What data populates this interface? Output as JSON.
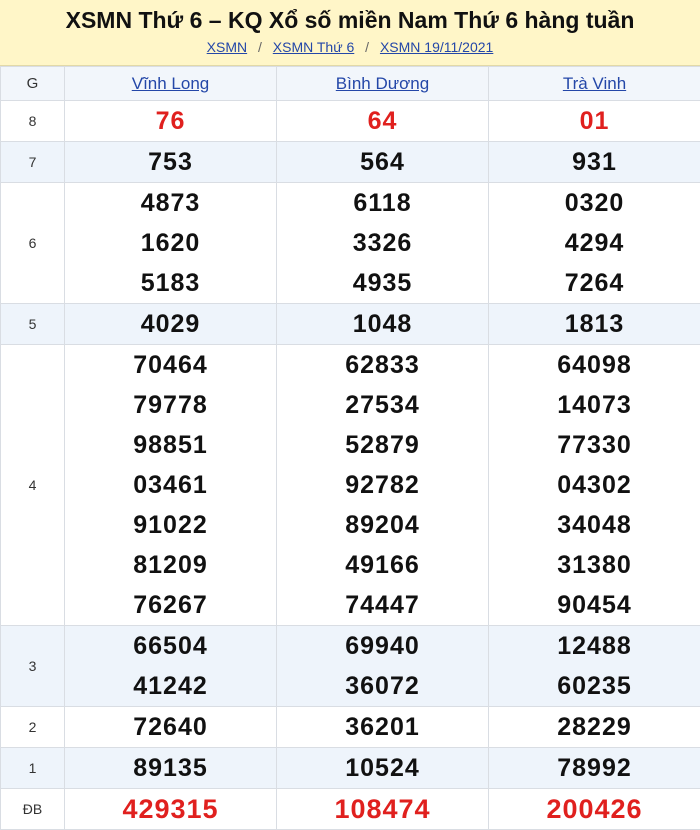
{
  "header": {
    "title": "XSMN Thứ 6 – KQ Xổ số miền Nam Thứ 6 hàng tuần",
    "breadcrumbs": [
      "XSMN",
      "XSMN Thứ 6",
      "XSMN 19/11/2021"
    ],
    "separator": "/"
  },
  "table": {
    "col_label": "G",
    "provinces": [
      "Vĩnh Long",
      "Bình Dương",
      "Trà Vinh"
    ],
    "rows": [
      {
        "label": "8",
        "highlight": true,
        "alt": false,
        "values": [
          [
            "76"
          ],
          [
            "64"
          ],
          [
            "01"
          ]
        ]
      },
      {
        "label": "7",
        "highlight": false,
        "alt": true,
        "values": [
          [
            "753"
          ],
          [
            "564"
          ],
          [
            "931"
          ]
        ]
      },
      {
        "label": "6",
        "highlight": false,
        "alt": false,
        "values": [
          [
            "4873",
            "1620",
            "5183"
          ],
          [
            "6118",
            "3326",
            "4935"
          ],
          [
            "0320",
            "4294",
            "7264"
          ]
        ]
      },
      {
        "label": "5",
        "highlight": false,
        "alt": true,
        "values": [
          [
            "4029"
          ],
          [
            "1048"
          ],
          [
            "1813"
          ]
        ]
      },
      {
        "label": "4",
        "highlight": false,
        "alt": false,
        "values": [
          [
            "70464",
            "79778",
            "98851",
            "03461",
            "91022",
            "81209",
            "76267"
          ],
          [
            "62833",
            "27534",
            "52879",
            "92782",
            "89204",
            "49166",
            "74447"
          ],
          [
            "64098",
            "14073",
            "77330",
            "04302",
            "34048",
            "31380",
            "90454"
          ]
        ]
      },
      {
        "label": "3",
        "highlight": false,
        "alt": true,
        "values": [
          [
            "66504",
            "41242"
          ],
          [
            "69940",
            "36072"
          ],
          [
            "12488",
            "60235"
          ]
        ]
      },
      {
        "label": "2",
        "highlight": false,
        "alt": false,
        "values": [
          [
            "72640"
          ],
          [
            "36201"
          ],
          [
            "28229"
          ]
        ]
      },
      {
        "label": "1",
        "highlight": false,
        "alt": true,
        "values": [
          [
            "89135"
          ],
          [
            "10524"
          ],
          [
            "78992"
          ]
        ]
      },
      {
        "label": "ĐB",
        "highlight": true,
        "alt": false,
        "values": [
          [
            "429315"
          ],
          [
            "108474"
          ],
          [
            "200426"
          ]
        ]
      }
    ]
  },
  "colors": {
    "header_bg": "#fff6c8",
    "link": "#2447a8",
    "special_number": "#e0201e",
    "alt_row_bg": "#eef4fb"
  }
}
